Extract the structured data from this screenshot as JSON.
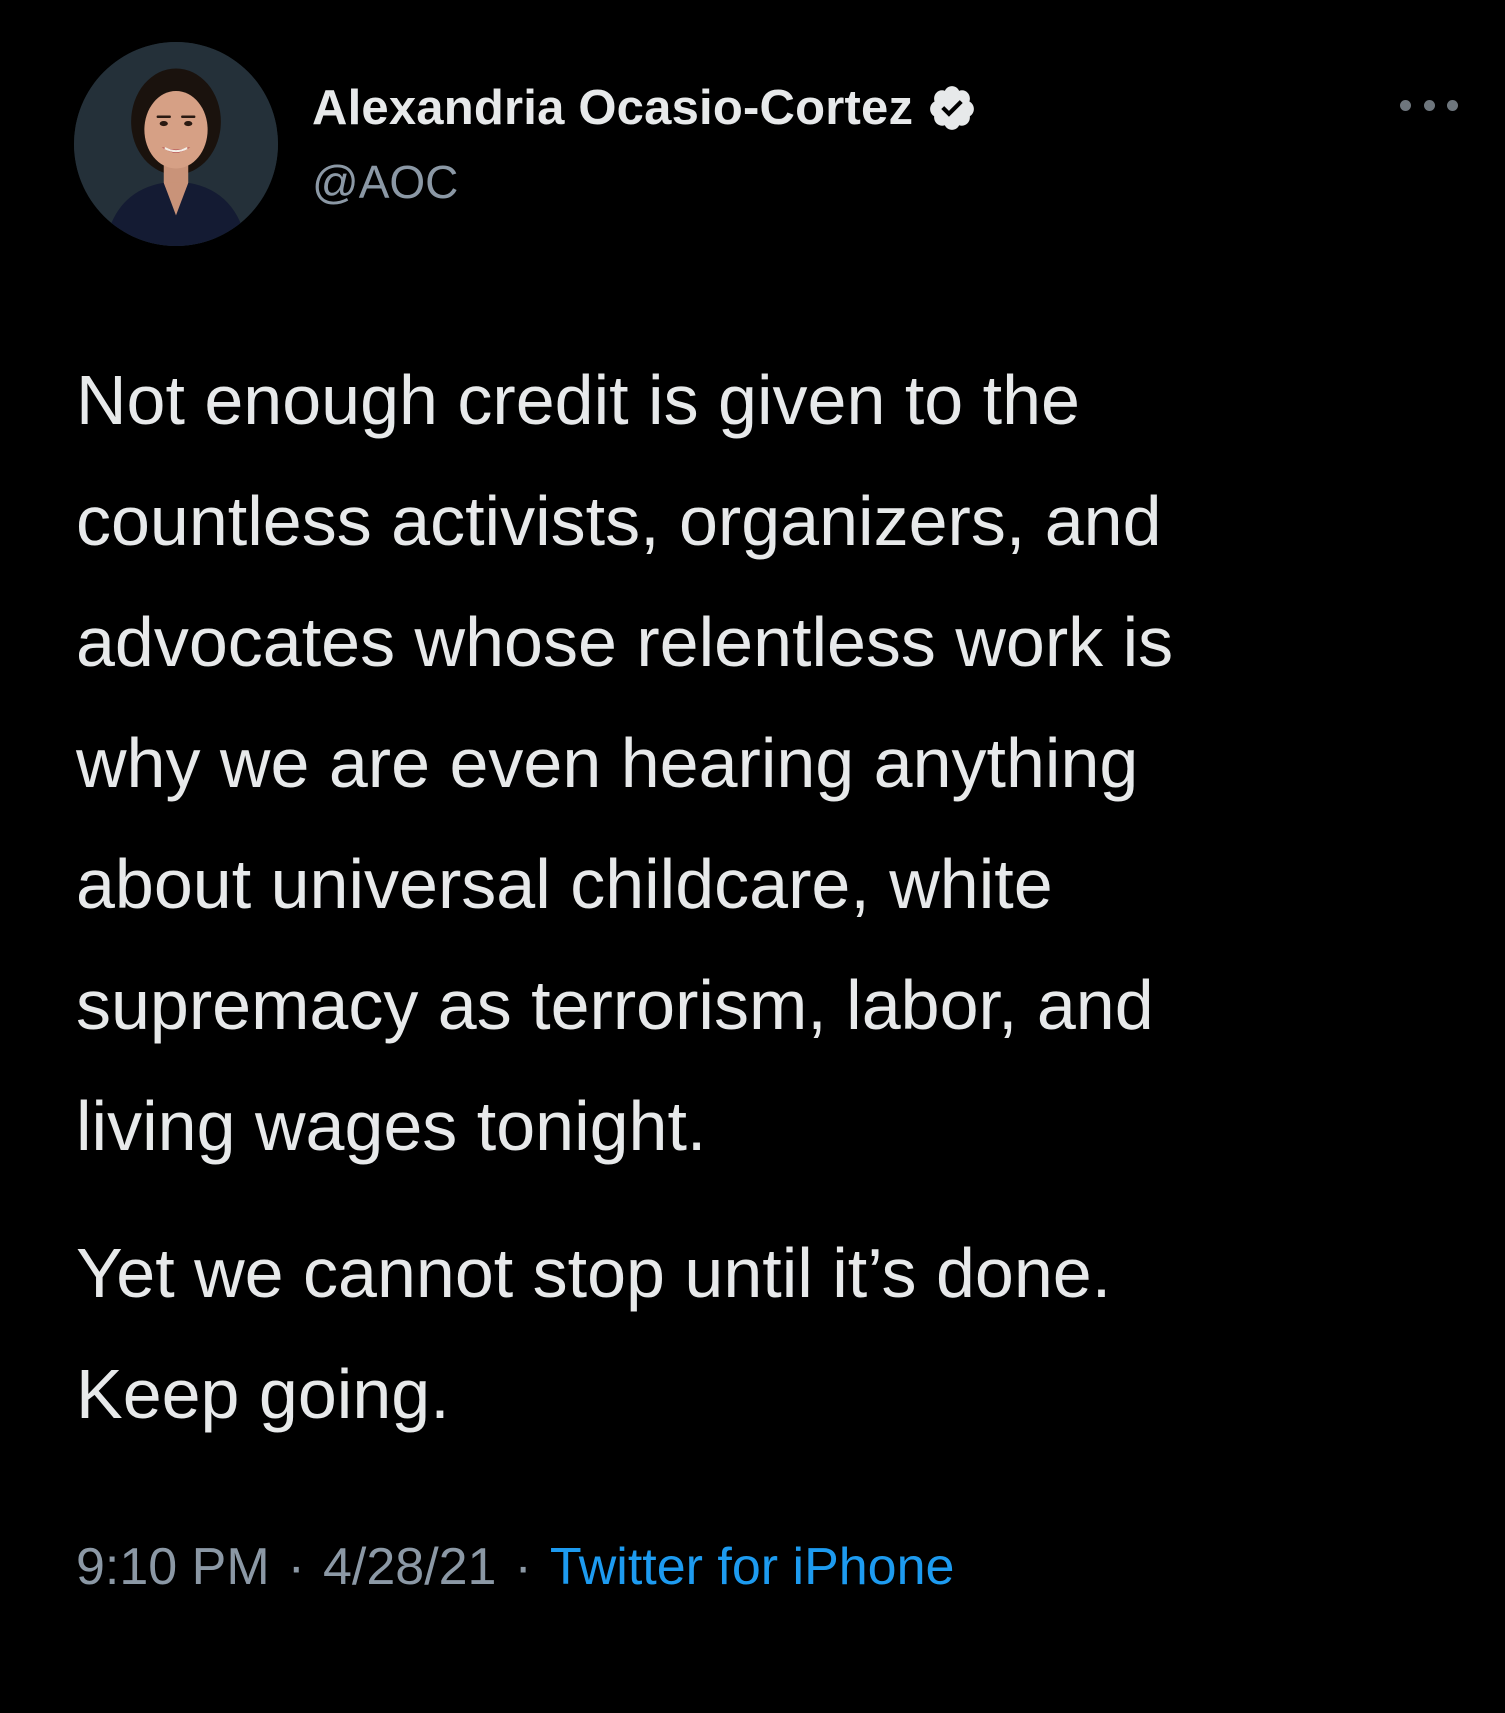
{
  "tweet": {
    "author": {
      "display_name": "Alexandria Ocasio-Cortez",
      "handle": "@AOC",
      "verified": true,
      "avatar_icon": "profile-photo"
    },
    "more_icon": "ellipsis-icon",
    "text_lines": [
      "Not enough credit is given to the",
      "countless activists, organizers, and",
      "advocates whose relentless work is",
      "why we are even hearing anything",
      "about universal childcare, white",
      "supremacy as terrorism, labor, and",
      "living wages tonight."
    ],
    "text_lines_2": [
      "Yet we cannot stop until it’s done.",
      "Keep going."
    ],
    "time": "9:10 PM",
    "date": "4/28/21",
    "separator": "·",
    "source": "Twitter for iPhone"
  },
  "colors": {
    "background": "#000000",
    "text": "#e7e9ea",
    "secondary_text": "#8b98a5",
    "link": "#1d9bf0"
  }
}
